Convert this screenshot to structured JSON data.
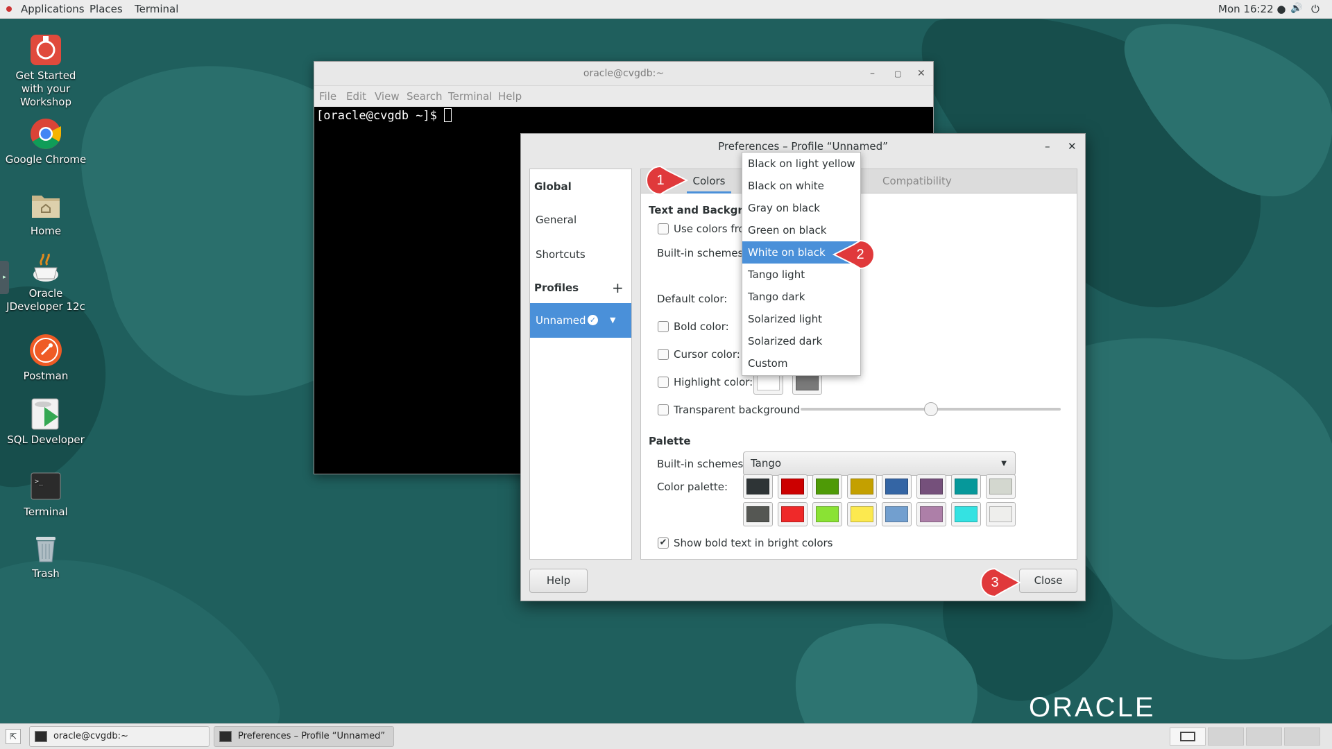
{
  "topbar": {
    "applications": "Applications",
    "places": "Places",
    "terminal": "Terminal",
    "clock": "Mon 16:22 ●"
  },
  "desktop": {
    "icons": [
      {
        "label": "Get Started with your Workshop",
        "icon": "workshop-icon"
      },
      {
        "label": "Google Chrome",
        "icon": "chrome-icon"
      },
      {
        "label": "Home",
        "icon": "home-folder-icon"
      },
      {
        "label": "Oracle JDeveloper 12c",
        "icon": "jdeveloper-icon"
      },
      {
        "label": "Postman",
        "icon": "postman-icon"
      },
      {
        "label": "SQL Developer",
        "icon": "sql-developer-icon"
      },
      {
        "label": "Terminal",
        "icon": "terminal-icon"
      },
      {
        "label": "Trash",
        "icon": "trash-icon"
      }
    ],
    "brand": "ORACLE"
  },
  "terminal": {
    "title": "oracle@cvgdb:~",
    "menu": [
      "File",
      "Edit",
      "View",
      "Search",
      "Terminal",
      "Help"
    ],
    "prompt": "[oracle@cvgdb ~]$ "
  },
  "dialog": {
    "title": "Preferences – Profile “Unnamed”",
    "sidebar": {
      "global": "Global",
      "general": "General",
      "shortcuts": "Shortcuts",
      "profiles": "Profiles",
      "add": "+",
      "unnamed": "Unnamed"
    },
    "tabs": {
      "colors": "Colors",
      "compatibility": "Compatibility"
    },
    "text_bg": {
      "heading": "Text and Background",
      "use_colors": "Use colors from",
      "builtin": "Built-in schemes:",
      "default_color": "Default color:",
      "bold_color": "Bold color:",
      "cursor_color": "Cursor color:",
      "highlight_color": "Highlight color:",
      "transparent": "Transparent background",
      "transparency_level": 0.5
    },
    "palette": {
      "heading": "Palette",
      "builtin": "Built-in schemes:",
      "selected": "Tango",
      "color_palette": "Color palette:",
      "row1": [
        "#2e3436",
        "#cc0000",
        "#4e9a06",
        "#c4a000",
        "#3465a4",
        "#75507b",
        "#06989a",
        "#d3d7cf"
      ],
      "row2": [
        "#555753",
        "#ef2929",
        "#8ae234",
        "#fce94f",
        "#729fcf",
        "#ad7fa8",
        "#34e2e2",
        "#eeeeec"
      ],
      "bold_bright": "Show bold text in bright colors",
      "bold_bright_checked": true
    },
    "help": "Help",
    "close": "Close",
    "dropdown": {
      "items": [
        "Black on light yellow",
        "Black on white",
        "Gray on black",
        "Green on black",
        "White on black",
        "Tango light",
        "Tango dark",
        "Solarized light",
        "Solarized dark",
        "Custom"
      ],
      "selected": "White on black"
    }
  },
  "callouts": [
    "1",
    "2",
    "3"
  ],
  "taskbar": {
    "items": [
      "oracle@cvgdb:~",
      "Preferences – Profile “Unnamed”"
    ]
  },
  "colors": {
    "accent": "#4a90d9",
    "callout": "#e0393b",
    "desktop": "#1d5c5a"
  }
}
